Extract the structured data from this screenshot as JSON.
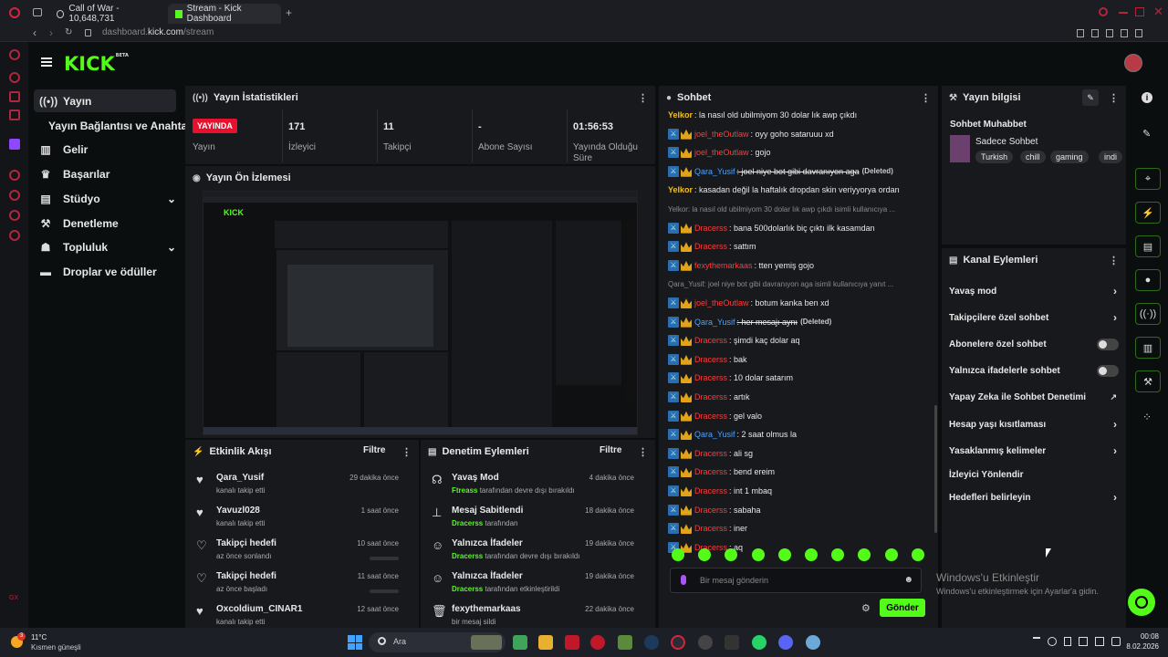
{
  "browser": {
    "tabs": [
      {
        "label": "Call of War - 10,648,731"
      },
      {
        "label": "Stream - Kick Dashboard"
      }
    ],
    "url_prefix": "dashboard.",
    "url_host": "kick.com",
    "url_path": "/stream"
  },
  "header": {
    "logo": "KICK",
    "logo_sup": "BETA"
  },
  "leftnav": {
    "items": [
      {
        "label": "Yayın",
        "icon": "broadcast-icon"
      },
      {
        "label": "Yayın Bağlantısı ve Anahtarı",
        "icon": ""
      },
      {
        "label": "Gelir",
        "icon": "chart-icon"
      },
      {
        "label": "Başarılar",
        "icon": "trophy-icon"
      },
      {
        "label": "Stüdyo",
        "icon": "studio-icon"
      },
      {
        "label": "Denetleme",
        "icon": "wrench-icon"
      },
      {
        "label": "Topluluk",
        "icon": "community-icon"
      },
      {
        "label": "Droplar ve ödüller",
        "icon": "drops-icon"
      }
    ]
  },
  "stats": {
    "title": "Yayın İstatistikleri",
    "live_badge": "YAYINDA",
    "items": [
      {
        "value": "",
        "label": "Yayın"
      },
      {
        "value": "171",
        "label": "İzleyici"
      },
      {
        "value": "11",
        "label": "Takipçi"
      },
      {
        "value": "-",
        "label": "Abone Sayısı"
      },
      {
        "value": "01:56:53",
        "label": "Yayında Olduğu Süre"
      }
    ]
  },
  "preview": {
    "title": "Yayın Ön İzlemesi"
  },
  "activity": {
    "title": "Etkinlik Akışı",
    "filter": "Filtre",
    "rows": [
      {
        "title": "Qara_Yusif",
        "sub": "kanalı takip etti",
        "time": "29 dakika önce",
        "icon": "heart"
      },
      {
        "title": "Yavuzl028",
        "sub": "kanalı takip etti",
        "time": "1 saat önce",
        "icon": "heart"
      },
      {
        "title": "Takipçi hedefi",
        "sub": "az önce sonlandı",
        "time": "10 saat önce",
        "icon": "heart-outline"
      },
      {
        "title": "Takipçi hedefi",
        "sub": "az önce başladı",
        "time": "11 saat önce",
        "icon": "heart-outline"
      },
      {
        "title": "Oxcoldium_CINAR1",
        "sub": "kanalı takip etti",
        "time": "12 saat önce",
        "icon": "heart"
      }
    ]
  },
  "modactions": {
    "title": "Denetim Eylemleri",
    "filter": "Filtre",
    "rows": [
      {
        "title": "Yavaş Mod",
        "user": "Ftreass",
        "sub": " tarafından devre dışı bırakıldı",
        "time": "4 dakika önce"
      },
      {
        "title": "Mesaj Sabitlendi",
        "user": "Dracerss",
        "sub": " tarafından",
        "time": "18 dakika önce"
      },
      {
        "title": "Yalnızca İfadeler",
        "user": "Dracerss",
        "sub": " tarafından devre dışı bırakıldı",
        "time": "19 dakika önce"
      },
      {
        "title": "Yalnızca İfadeler",
        "user": "Dracerss",
        "sub": " tarafından etkinleştirildi",
        "time": "19 dakika önce"
      },
      {
        "title": "fexythemarkaas",
        "user": "",
        "sub": "bir mesaj sildi",
        "time": "22 dakika önce"
      }
    ]
  },
  "chat": {
    "title": "Sohbet",
    "input_placeholder": "Bir mesaj gönderin",
    "send": "Gönder",
    "messages": [
      {
        "type": "plain",
        "user": "Yelkor",
        "text": ": la nasıl old ubilmiyom 30 dolar lık awp çıkdı"
      },
      {
        "type": "badge",
        "user": "joel_theOutlaw",
        "color": "red",
        "text": ": oyy goho sataruuu xd"
      },
      {
        "type": "badge",
        "user": "joel_theOutlaw",
        "color": "red",
        "text": ": gojo"
      },
      {
        "type": "badge",
        "user": "Qara_Yusif",
        "color": "blue",
        "text": ": joel niye bot gibi davranıyon aga",
        "deleted": "(Deleted)"
      },
      {
        "type": "plain",
        "user": "Yelkor",
        "text": ": kasadan değil la haftalık dropdan skin veriyyorya ordan"
      },
      {
        "type": "reply",
        "text": "Yelkor: la nasıl old ubilmiyom 30 dolar lık awp çıkdı isimli kullanıcıya ..."
      },
      {
        "type": "badge",
        "user": "Dracerss",
        "color": "red",
        "text": ": bana 500dolarlık biç çıktı ilk kasamdan"
      },
      {
        "type": "badge",
        "user": "Dracerss",
        "color": "red",
        "text": ": sattım"
      },
      {
        "type": "badge",
        "user": "fexythemarkaas",
        "color": "red",
        "text": ": tten yemiş gojo"
      },
      {
        "type": "reply",
        "text": "Qara_Yusif: joel niye bot gibi davranıyon aga isimli kullanıcıya yanıt ..."
      },
      {
        "type": "badge",
        "user": "joel_theOutlaw",
        "color": "red",
        "text": ": botum kanka ben xd"
      },
      {
        "type": "badge",
        "user": "Qara_Yusif",
        "color": "blue",
        "text": ": her mesajı aynı",
        "deleted": "(Deleted)"
      },
      {
        "type": "badge",
        "user": "Dracerss",
        "color": "red",
        "text": ": şimdi kaç dolar aq"
      },
      {
        "type": "badge",
        "user": "Dracerss",
        "color": "red",
        "text": ": bak"
      },
      {
        "type": "badge",
        "user": "Dracerss",
        "color": "red",
        "text": ": 10 dolar satarım"
      },
      {
        "type": "badge",
        "user": "Dracerss",
        "color": "red",
        "text": ": artık"
      },
      {
        "type": "badge",
        "user": "Dracerss",
        "color": "red",
        "text": ": gel valo"
      },
      {
        "type": "badge",
        "user": "Qara_Yusif",
        "color": "blue",
        "text": ": 2 saat olmus la"
      },
      {
        "type": "badge",
        "user": "Dracerss",
        "color": "red",
        "text": ": ali sg"
      },
      {
        "type": "badge",
        "user": "Dracerss",
        "color": "red",
        "text": ": bend ereim"
      },
      {
        "type": "badge",
        "user": "Dracerss",
        "color": "red",
        "text": ": int 1 mbaq"
      },
      {
        "type": "badge",
        "user": "Dracerss",
        "color": "red",
        "text": ": sabaha"
      },
      {
        "type": "badge",
        "user": "Dracerss",
        "color": "red",
        "text": ": iner"
      },
      {
        "type": "badge",
        "user": "Dracerss",
        "color": "red",
        "text": ": aq"
      }
    ]
  },
  "streaminfo": {
    "title": "Yayın bilgisi",
    "stream_title": "Sohbet Muhabbet",
    "category": "Sadece Sohbet",
    "tags": [
      "Turkish",
      "chill",
      "gaming",
      "indi"
    ]
  },
  "channelactions": {
    "title": "Kanal Eylemleri",
    "rows": [
      {
        "label": "Yavaş mod",
        "ctrl": "chevron"
      },
      {
        "label": "Takipçilere özel sohbet",
        "ctrl": "chevron"
      },
      {
        "label": "Abonelere özel sohbet",
        "ctrl": "toggle"
      },
      {
        "label": "Yalnızca ifadelerle sohbet",
        "ctrl": "toggle"
      },
      {
        "label": "Yapay Zeka ile Sohbet Denetimi",
        "ctrl": "external"
      },
      {
        "label": "Hesap yaşı kısıtlaması",
        "ctrl": "chevron"
      },
      {
        "label": "Yasaklanmış kelimeler",
        "ctrl": "chevron"
      },
      {
        "label": "İzleyici Yönlendir",
        "ctrl": ""
      },
      {
        "label": "Hedefleri belirleyin",
        "ctrl": "chevron"
      }
    ]
  },
  "watermark": {
    "title": "Windows'u Etkinleştir",
    "sub": "Windows'u etkinleştirmek için Ayarlar'a gidin."
  },
  "taskbar": {
    "weather_temp": "11°C",
    "weather_desc": "Kısmen güneşli",
    "search": "Ara",
    "time": "00:08",
    "date": "8.02.2026",
    "notif_count": "3"
  },
  "colors": {
    "accent": "#53fc18",
    "live": "#e8112d",
    "panel": "#18191d",
    "background": "#0b0e0f"
  }
}
